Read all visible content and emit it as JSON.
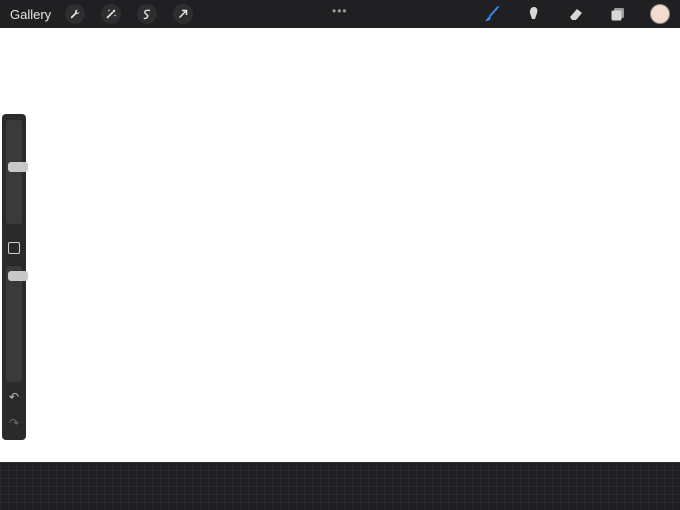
{
  "topbar": {
    "gallery_label": "Gallery",
    "left_tools": [
      "wrench-icon",
      "magic-wand-icon",
      "selection-icon",
      "transform-arrow-icon"
    ],
    "more_label": "•••",
    "right_tools": [
      "brush-icon",
      "smudge-icon",
      "eraser-icon",
      "layers-icon"
    ],
    "active_tool": "brush-icon",
    "current_color": "#f3dccd"
  },
  "sidebar": {
    "brush_size_level": 0.55,
    "opacity_level": 0.95,
    "undo_label": "↶",
    "redo_label": "↷"
  },
  "canvas": {
    "placeholder": ""
  },
  "colors": {
    "accent": "#3a84e6",
    "toolbar_bg": "#202022"
  }
}
